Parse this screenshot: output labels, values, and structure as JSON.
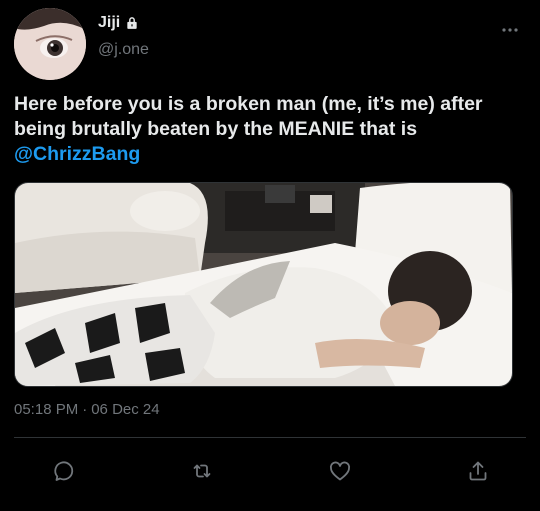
{
  "author": {
    "display_name": "Jiji",
    "handle": "@j.one",
    "protected_icon": "lock-icon",
    "avatar_icon": "avatar"
  },
  "tweet": {
    "text_before_mention": "Here before you is a broken man (me, it’s me) after being brutally beaten by the MEANIE that is ",
    "mention": "@ChrizzBang",
    "media_description_icon": "photo",
    "time": "05:18 PM",
    "separator": "·",
    "date": "06 Dec 24"
  },
  "actions": [
    {
      "name": "reply",
      "icon": "reply-icon"
    },
    {
      "name": "retweet",
      "icon": "retweet-icon"
    },
    {
      "name": "like",
      "icon": "heart-icon"
    },
    {
      "name": "share",
      "icon": "share-icon"
    }
  ],
  "colors": {
    "background": "#000000",
    "text": "#e7e9ea",
    "secondary": "#71767b",
    "accent": "#1d9bf0",
    "divider": "#2f3336"
  }
}
